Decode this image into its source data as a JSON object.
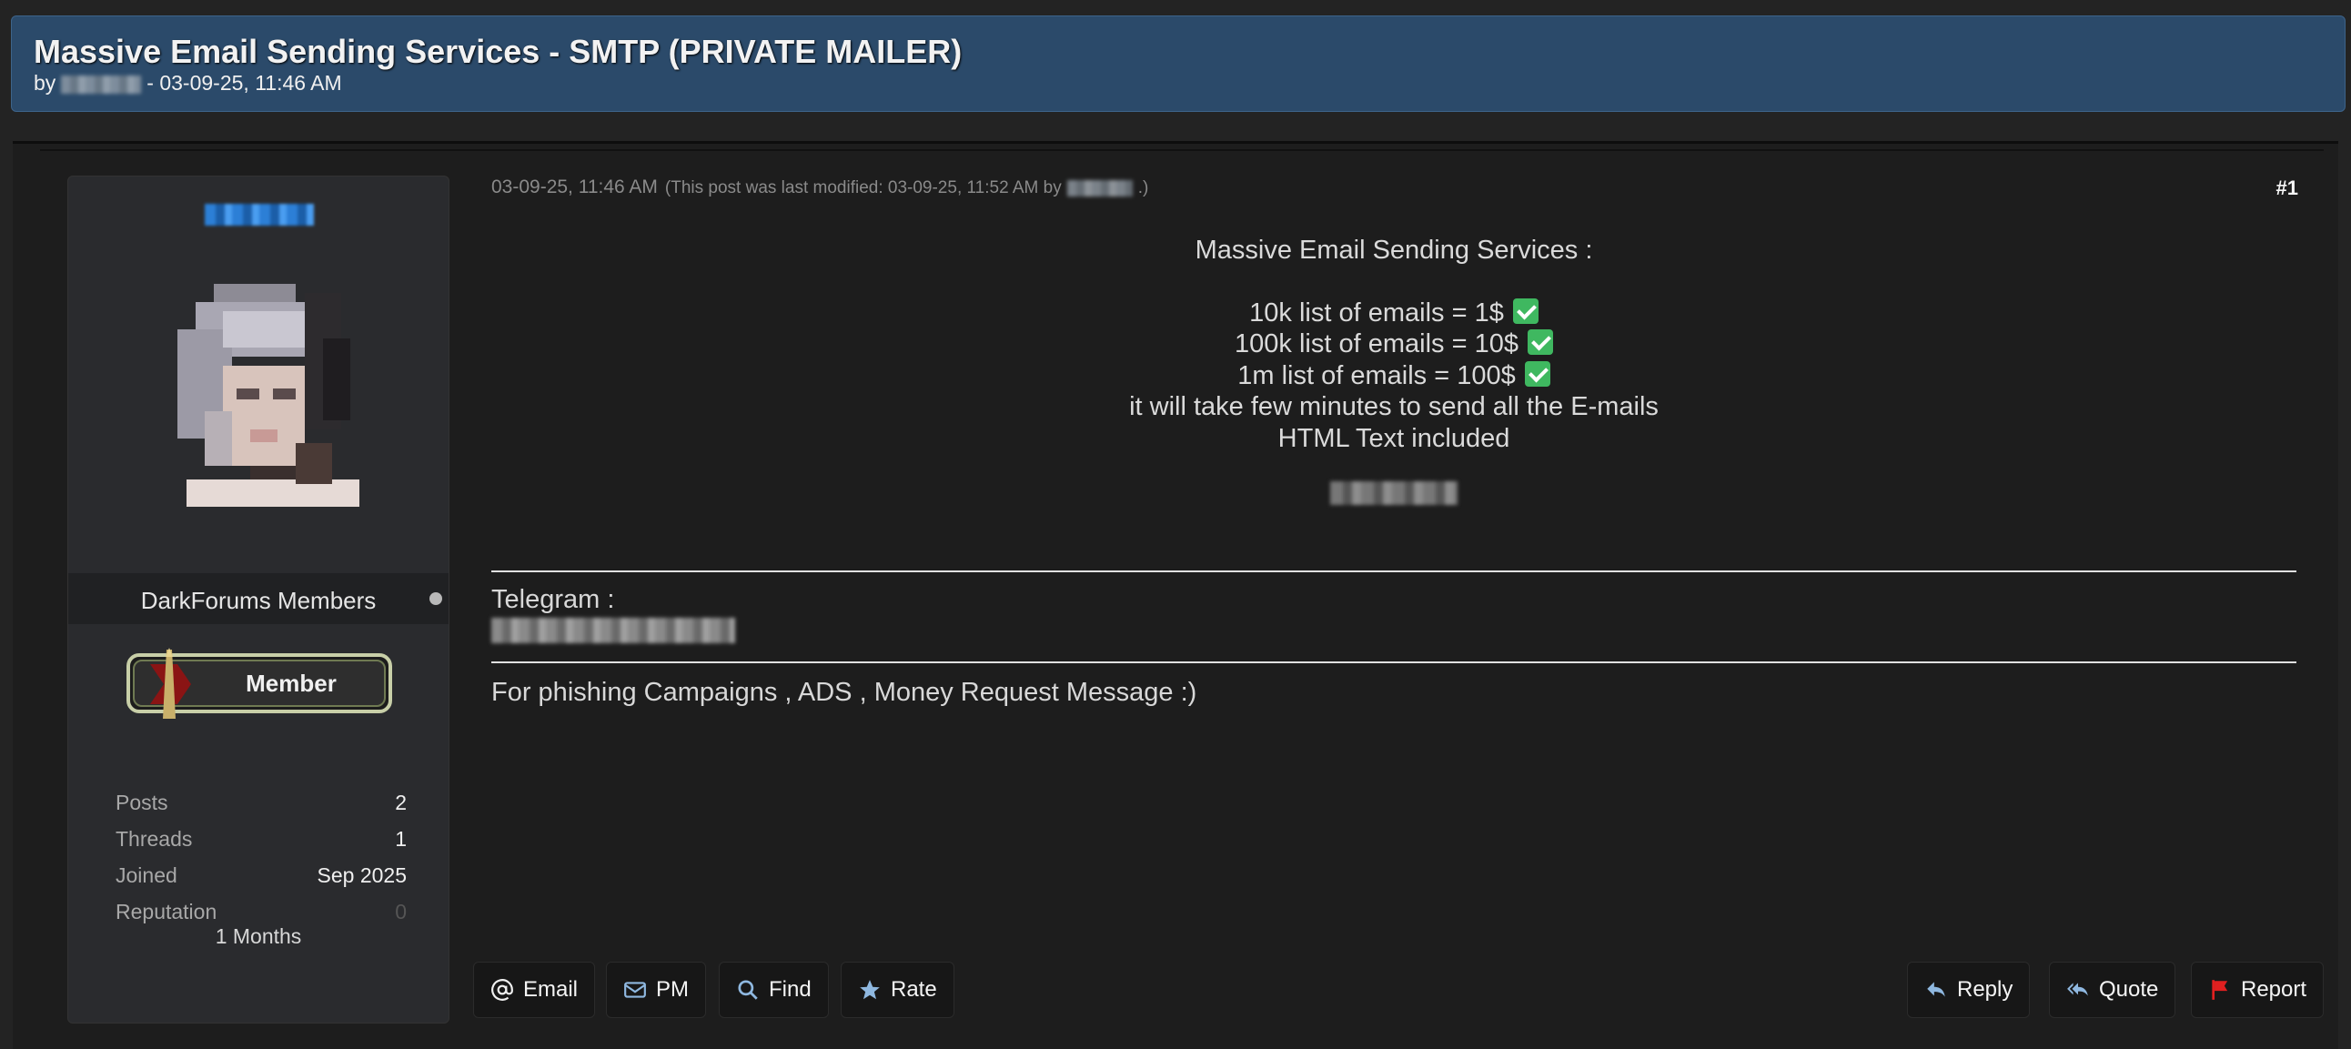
{
  "thread": {
    "title": "Massive Email Sending Services - SMTP (PRIVATE MAILER)",
    "by_prefix": "by",
    "meta_suffix": "- 03-09-25, 11:46 AM"
  },
  "author": {
    "group": "DarkForums Members",
    "rank": "Member",
    "stats": [
      {
        "label": "Posts",
        "value": "2"
      },
      {
        "label": "Threads",
        "value": "1"
      },
      {
        "label": "Joined",
        "value": "Sep 2025"
      },
      {
        "label": "Reputation",
        "value": "0"
      }
    ],
    "age": "1 Months"
  },
  "post": {
    "date": "03-09-25, 11:46 AM",
    "modified_prefix": "(This post was last modified: 03-09-25, 11:52 AM by",
    "modified_suffix": ".)",
    "number": "#1",
    "heading": "Massive Email Sending Services  :",
    "offers": [
      "10k list of emails = 1$",
      "100k list of emails = 10$",
      "1m list of emails = 100$"
    ],
    "note1": "it will take few minutes to send all the E-mails",
    "note2": "HTML Text included",
    "telegram_label": "Telegram :",
    "footer_text": "For phishing Campaigns , ADS , Money Request Message :)"
  },
  "actions": {
    "email": "Email",
    "pm": "PM",
    "find": "Find",
    "rate": "Rate",
    "reply": "Reply",
    "quote": "Quote",
    "report": "Report"
  },
  "colors": {
    "header_bg": "#2b4a6a",
    "post_bg": "#1d1d1d",
    "sidebar_bg": "#2a2b2e",
    "check_green": "#3fb860",
    "report_red": "#e02020",
    "icon_blue": "#8fb8e0"
  }
}
